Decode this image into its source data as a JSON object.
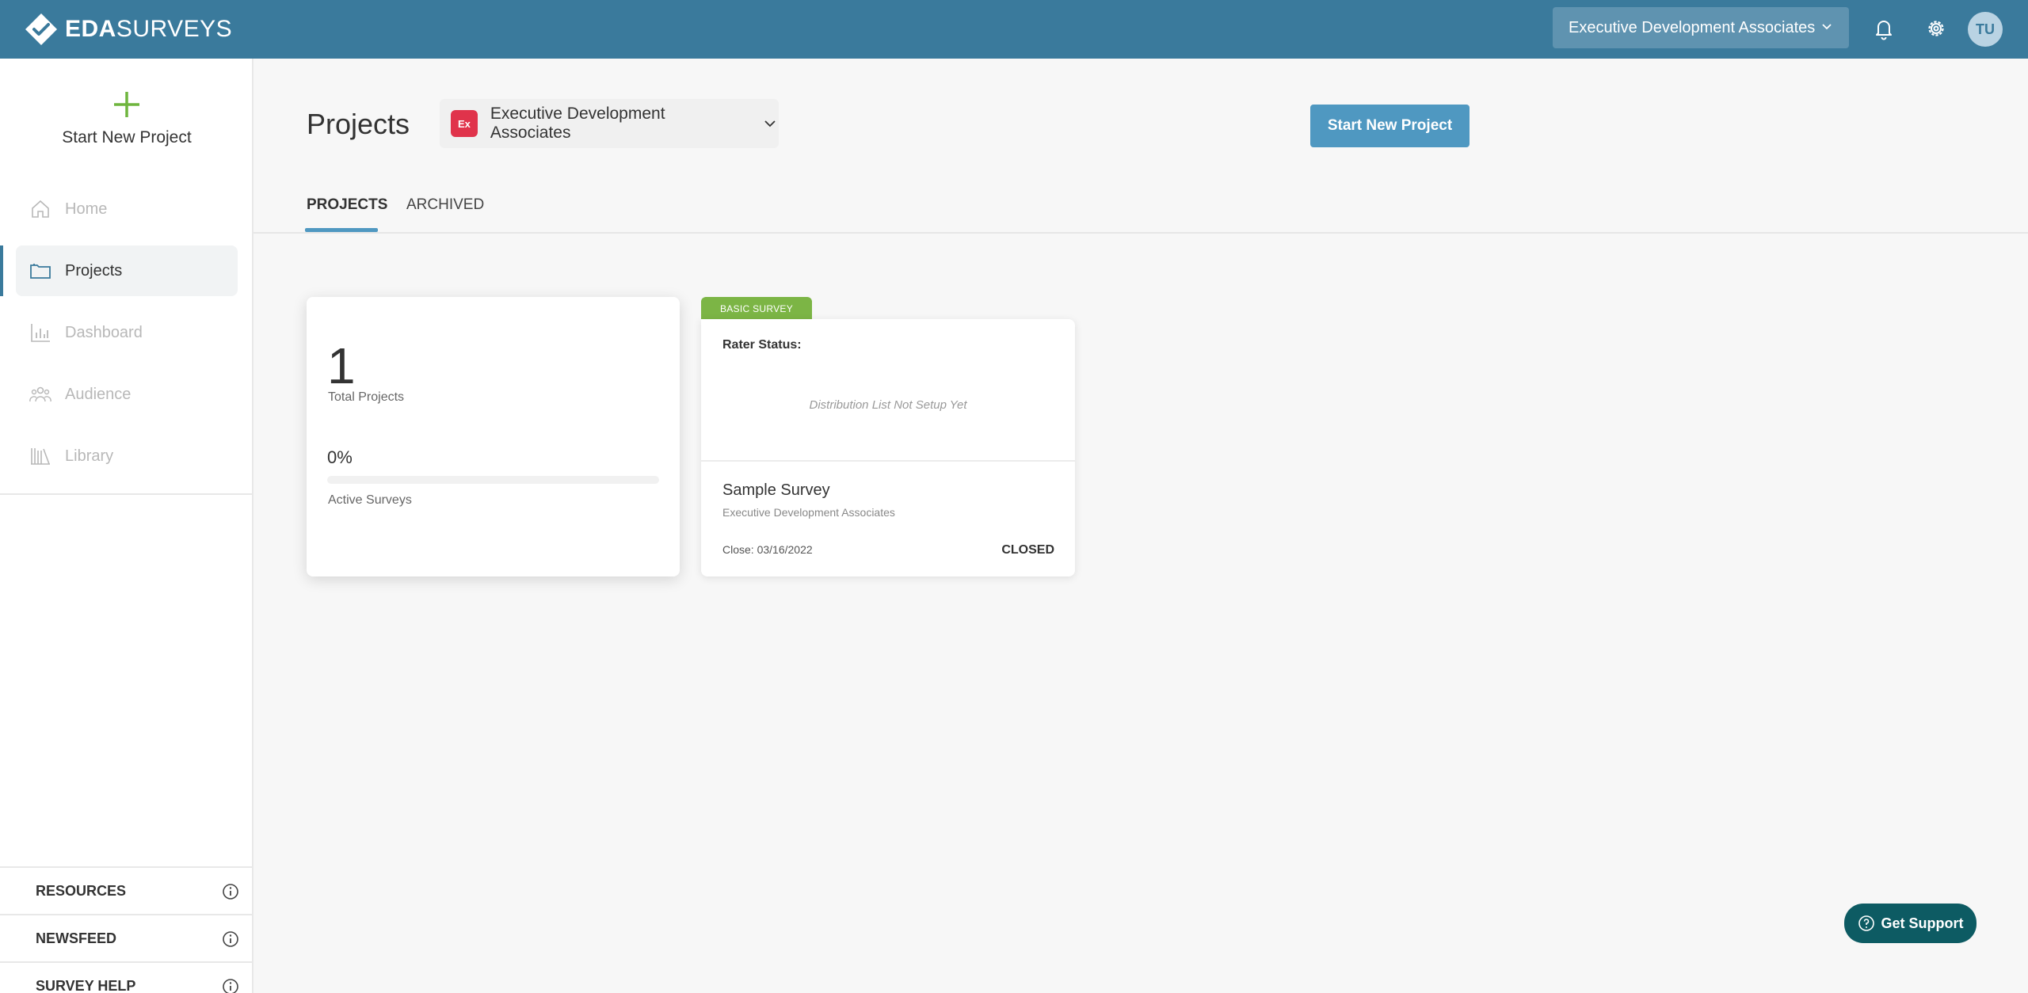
{
  "brand": {
    "name_bold": "EDA",
    "name_light": "SURVEYS",
    "logo_icon": "diamond-check-icon"
  },
  "topbar": {
    "org_selector": "Executive Development Associates",
    "user_initials": "TU",
    "icons": [
      "bell-icon",
      "gear-icon"
    ]
  },
  "sidebar": {
    "start_new_label": "Start New Project",
    "nav": [
      {
        "label": "Home",
        "icon": "home-icon",
        "active": false
      },
      {
        "label": "Projects",
        "icon": "folder-icon",
        "active": true
      },
      {
        "label": "Dashboard",
        "icon": "bar-chart-icon",
        "active": false
      },
      {
        "label": "Audience",
        "icon": "people-icon",
        "active": false
      },
      {
        "label": "Library",
        "icon": "library-icon",
        "active": false
      }
    ],
    "footer": [
      {
        "label": "RESOURCES"
      },
      {
        "label": "NEWSFEED"
      },
      {
        "label": "SURVEY HELP"
      }
    ]
  },
  "main": {
    "title": "Projects",
    "org_pill": {
      "badge": "Ex",
      "label": "Executive Development Associates"
    },
    "start_button": "Start New Project",
    "tabs": [
      {
        "label": "PROJECTS",
        "active": true
      },
      {
        "label": "ARCHIVED",
        "active": false
      }
    ],
    "stats": {
      "total": "1",
      "total_label": "Total Projects",
      "active_pct": "0%",
      "active_fraction": 0,
      "active_label": "Active Surveys"
    },
    "survey_card": {
      "tag": "BASIC SURVEY",
      "rater_label": "Rater Status:",
      "distribution_note": "Distribution List Not Setup Yet",
      "name": "Sample Survey",
      "org": "Executive Development Associates",
      "close": "Close: 03/16/2022",
      "status": "CLOSED"
    }
  },
  "support": {
    "label": "Get Support"
  },
  "colors": {
    "topbar": "#3a7a9c",
    "accent": "#4f98c1",
    "tag_green": "#7cb545",
    "support": "#0d5b63",
    "badge_red": "#e0334b"
  }
}
